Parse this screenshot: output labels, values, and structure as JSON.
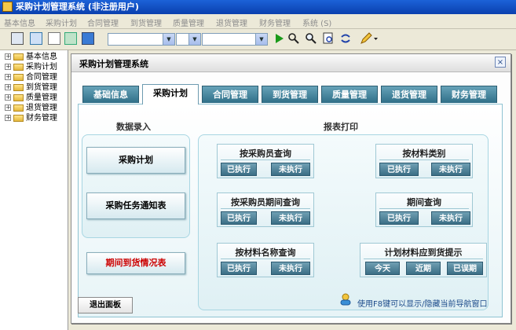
{
  "window": {
    "title": "采购计划管理系统 (非注册用户)"
  },
  "menu": [
    "基本信息",
    "采购计划",
    "合同管理",
    "到货管理",
    "质量管理",
    "退货管理",
    "财务管理",
    "系统 (S)"
  ],
  "tree": [
    "基本信息",
    "采购计划",
    "合同管理",
    "到货管理",
    "质量管理",
    "退货管理",
    "财务管理"
  ],
  "panel": {
    "title": "采购计划管理系统",
    "close": "×",
    "tabs": [
      "基础信息",
      "采购计划",
      "合同管理",
      "到货管理",
      "质量管理",
      "退货管理",
      "财务管理"
    ],
    "active_tab": "采购计划",
    "data_entry": {
      "title": "数据录入",
      "plan": "采购计划",
      "notice": "采购任务通知表",
      "period_arrival": "期间到货情况表"
    },
    "report": {
      "title": "报表打印",
      "by_buyer": {
        "title": "按采购员查询",
        "executed": "已执行",
        "unexecuted": "未执行"
      },
      "by_material_type": {
        "title": "按材料类别",
        "executed": "已执行",
        "unexecuted": "未执行"
      },
      "by_buyer_period": {
        "title": "按采购员期间查询",
        "executed": "已执行",
        "unexecuted": "未执行"
      },
      "period_query": {
        "title": "期间查询",
        "executed": "已执行",
        "unexecuted": "未执行"
      },
      "by_material_name": {
        "title": "按材料名称查询",
        "executed": "已执行",
        "unexecuted": "未执行"
      },
      "arrival_reminder": {
        "title": "计划材料应到货提示",
        "today": "今天",
        "recent": "近期",
        "overdue": "已误期"
      }
    },
    "exit": "退出面板",
    "hint": "使用F8键可以显示/隐藏当前导航窗口"
  },
  "colors": {
    "titlebar": "#0a3fae",
    "tab": "#3b7890",
    "button": "#3b6e85",
    "red_text": "#cc0000"
  }
}
